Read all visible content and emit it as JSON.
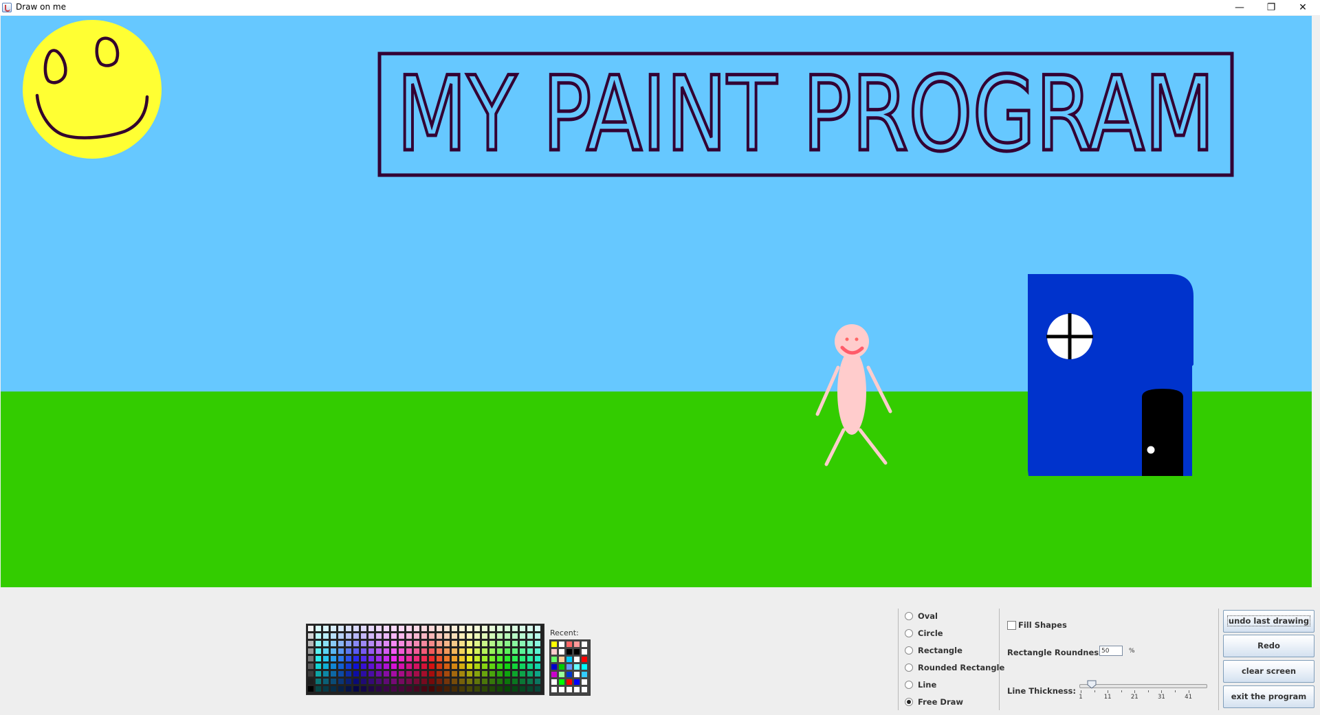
{
  "window": {
    "title": "Draw on me",
    "controls": {
      "minimize": "—",
      "restore": "❐",
      "close": "✕"
    }
  },
  "canvas": {
    "sky_color": "#66c8ff",
    "grass_color": "#33cc00",
    "title_text": "MY  PAINT PROGRAM",
    "drawing_items": [
      "smiley-sun",
      "title-banner",
      "stick-figure",
      "house"
    ]
  },
  "palette": {
    "recent_label": "Recent:",
    "recent_colors": [
      [
        "#ffff00",
        "#ffffff",
        "#ff6666",
        "#ff9999",
        "#ffffff"
      ],
      [
        "#ffcccc",
        "#ffffff",
        "#000000",
        "#000000",
        "#ffffff"
      ],
      [
        "#66ff66",
        "#ffcc99",
        "#00ccff",
        "#ffffff",
        "#ff0000"
      ],
      [
        "#0000cc",
        "#00cc00",
        "#6699ff",
        "#66ffff",
        "#00ffff"
      ],
      [
        "#cc00cc",
        "#99ff99",
        "#0033cc",
        "#ffffff",
        "#33ccff"
      ],
      [
        "#ffffff",
        "#00ff00",
        "#ff0000",
        "#0000ff",
        "#ffffff"
      ],
      [
        "#ffffff",
        "#ffffff",
        "#ffffff",
        "#ffffff",
        "#ffffff"
      ]
    ]
  },
  "shapes": {
    "options": [
      "Oval",
      "Circle",
      "Rectangle",
      "Rounded Rectangle",
      "Line",
      "Free Draw"
    ],
    "selected": "Free Draw"
  },
  "settings": {
    "fill_shapes_label": "Fill Shapes",
    "fill_shapes_checked": false,
    "roundness_label": "Rectangle Roundness:",
    "roundness_value": "50",
    "roundness_unit": "%",
    "thickness_label": "Line Thickness:",
    "thickness_value": 5,
    "thickness_ticks": [
      "1",
      "11",
      "21",
      "31",
      "41"
    ]
  },
  "actions": {
    "undo": "undo last drawing",
    "redo": "Redo",
    "clear": "clear screen",
    "exit": "exit the program"
  }
}
